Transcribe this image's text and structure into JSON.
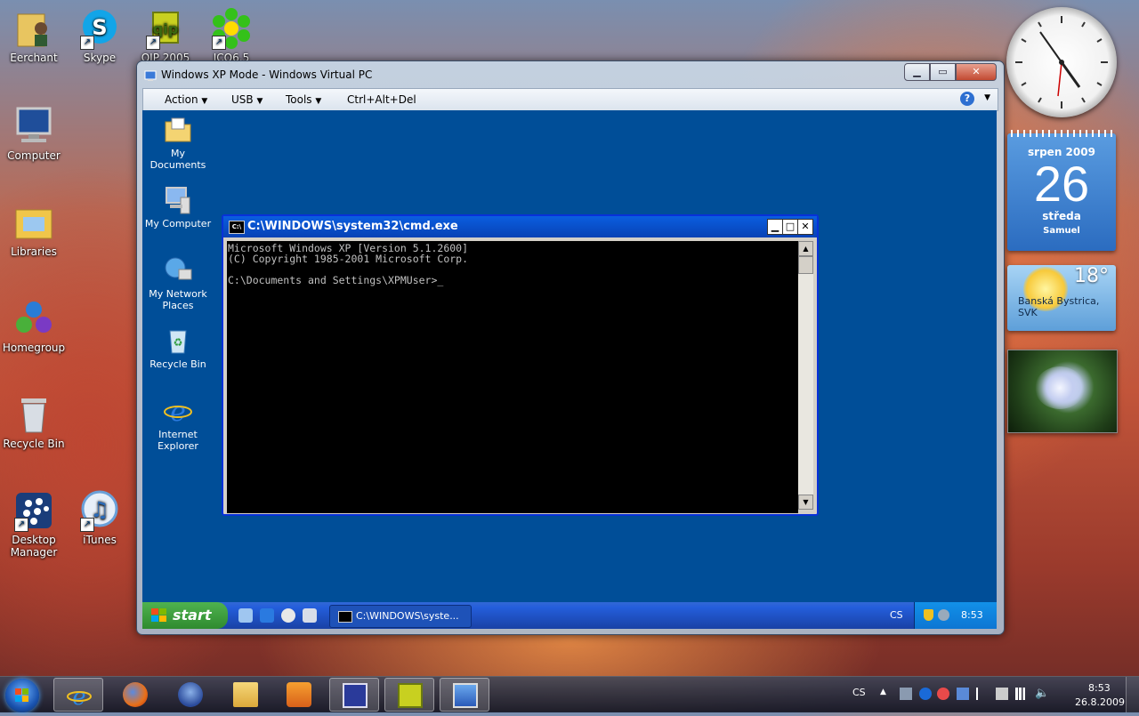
{
  "desktop_icons": [
    {
      "label": "Eerchant"
    },
    {
      "label": "Skype"
    },
    {
      "label": "QIP 2005"
    },
    {
      "label": "ICQ6.5"
    },
    {
      "label": "Computer"
    },
    {
      "label": "Libraries"
    },
    {
      "label": "Homegroup"
    },
    {
      "label": "Recycle Bin"
    },
    {
      "label": "Desktop Manager"
    },
    {
      "label": "iTunes"
    }
  ],
  "vpc": {
    "title": "Windows XP Mode - Windows Virtual PC",
    "menu": [
      "Action",
      "USB",
      "Tools",
      "Ctrl+Alt+Del"
    ],
    "help": "?"
  },
  "xp": {
    "icons": [
      {
        "label": "My Documents"
      },
      {
        "label": "My Computer"
      },
      {
        "label": "My Network Places"
      },
      {
        "label": "Recycle Bin"
      },
      {
        "label": "Internet Explorer"
      }
    ],
    "cmd": {
      "title": "C:\\WINDOWS\\system32\\cmd.exe",
      "console": "Microsoft Windows XP [Version 5.1.2600]\n(C) Copyright 1985-2001 Microsoft Corp.\n\nC:\\Documents and Settings\\XPMUser>_"
    },
    "taskbar": {
      "start": "start",
      "task": "C:\\WINDOWS\\syste...",
      "lang": "CS",
      "time": "8:53"
    }
  },
  "gadgets": {
    "calendar": {
      "month": "srpen 2009",
      "day": "26",
      "weekday": "středa",
      "name": "Samuel"
    },
    "weather": {
      "temp": "18°",
      "location": "Banská Bystrica, SVK"
    }
  },
  "taskbar": {
    "lang": "CS",
    "time": "8:53",
    "date": "26.8.2009"
  },
  "colors": {
    "xp_desktop": "#004e98",
    "cmd_title": "#0a5ee0",
    "xp_start": "#3a9d3a"
  }
}
